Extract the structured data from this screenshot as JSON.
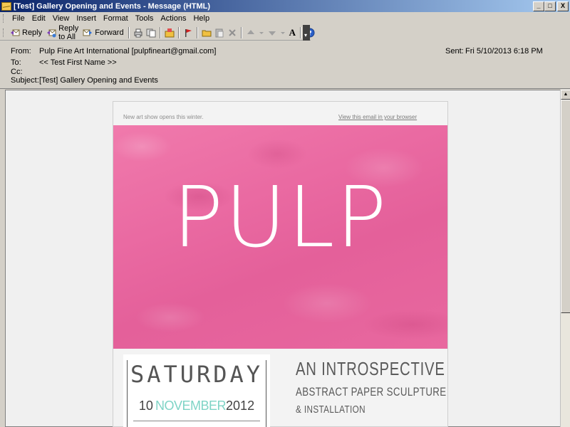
{
  "window": {
    "title": "[Test] Gallery Opening and Events - Message (HTML)",
    "controls": [
      "_",
      "□",
      "X"
    ]
  },
  "menu": [
    {
      "label": "File",
      "key": "F"
    },
    {
      "label": "Edit",
      "key": "E"
    },
    {
      "label": "View",
      "key": "V"
    },
    {
      "label": "Insert",
      "key": "I"
    },
    {
      "label": "Format",
      "key": "o"
    },
    {
      "label": "Tools",
      "key": "T"
    },
    {
      "label": "Actions",
      "key": "A"
    },
    {
      "label": "Help",
      "key": "H"
    }
  ],
  "toolbar": {
    "reply": "Reply",
    "reply_all": "Reply to All",
    "forward": "Forward",
    "font_size_label": "A"
  },
  "header": {
    "from_label": "From:",
    "from_value": "Pulp Fine Art International [pulpfineart@gmail.com]",
    "to_label": "To:",
    "to_value": "<< Test First Name >>",
    "cc_label": "Cc:",
    "cc_value": "",
    "subject_label": "Subject:",
    "subject_value": "[Test] Gallery Opening and Events",
    "sent_label": "Sent:",
    "sent_value": "Fri 5/10/2013 6:18 PM"
  },
  "email": {
    "preheader": "New art show opens this  winter.",
    "view_link": "View this email in your browser",
    "logo": "PULP",
    "event_day": "SATURDAY",
    "event_date_day": "10",
    "event_date_month": "NOVEMBER",
    "event_date_year": "2012",
    "tagline_1": "AN INTROSPECTIVE",
    "tagline_2": "ABSTRACT PAPER SCULPTURE",
    "tagline_3": "& INSTALLATION"
  },
  "colors": {
    "titlebar_start": "#0a246a",
    "titlebar_end": "#a6caf0",
    "hero_pink": "#ea6aa2",
    "month_teal": "#7fd4c6"
  }
}
